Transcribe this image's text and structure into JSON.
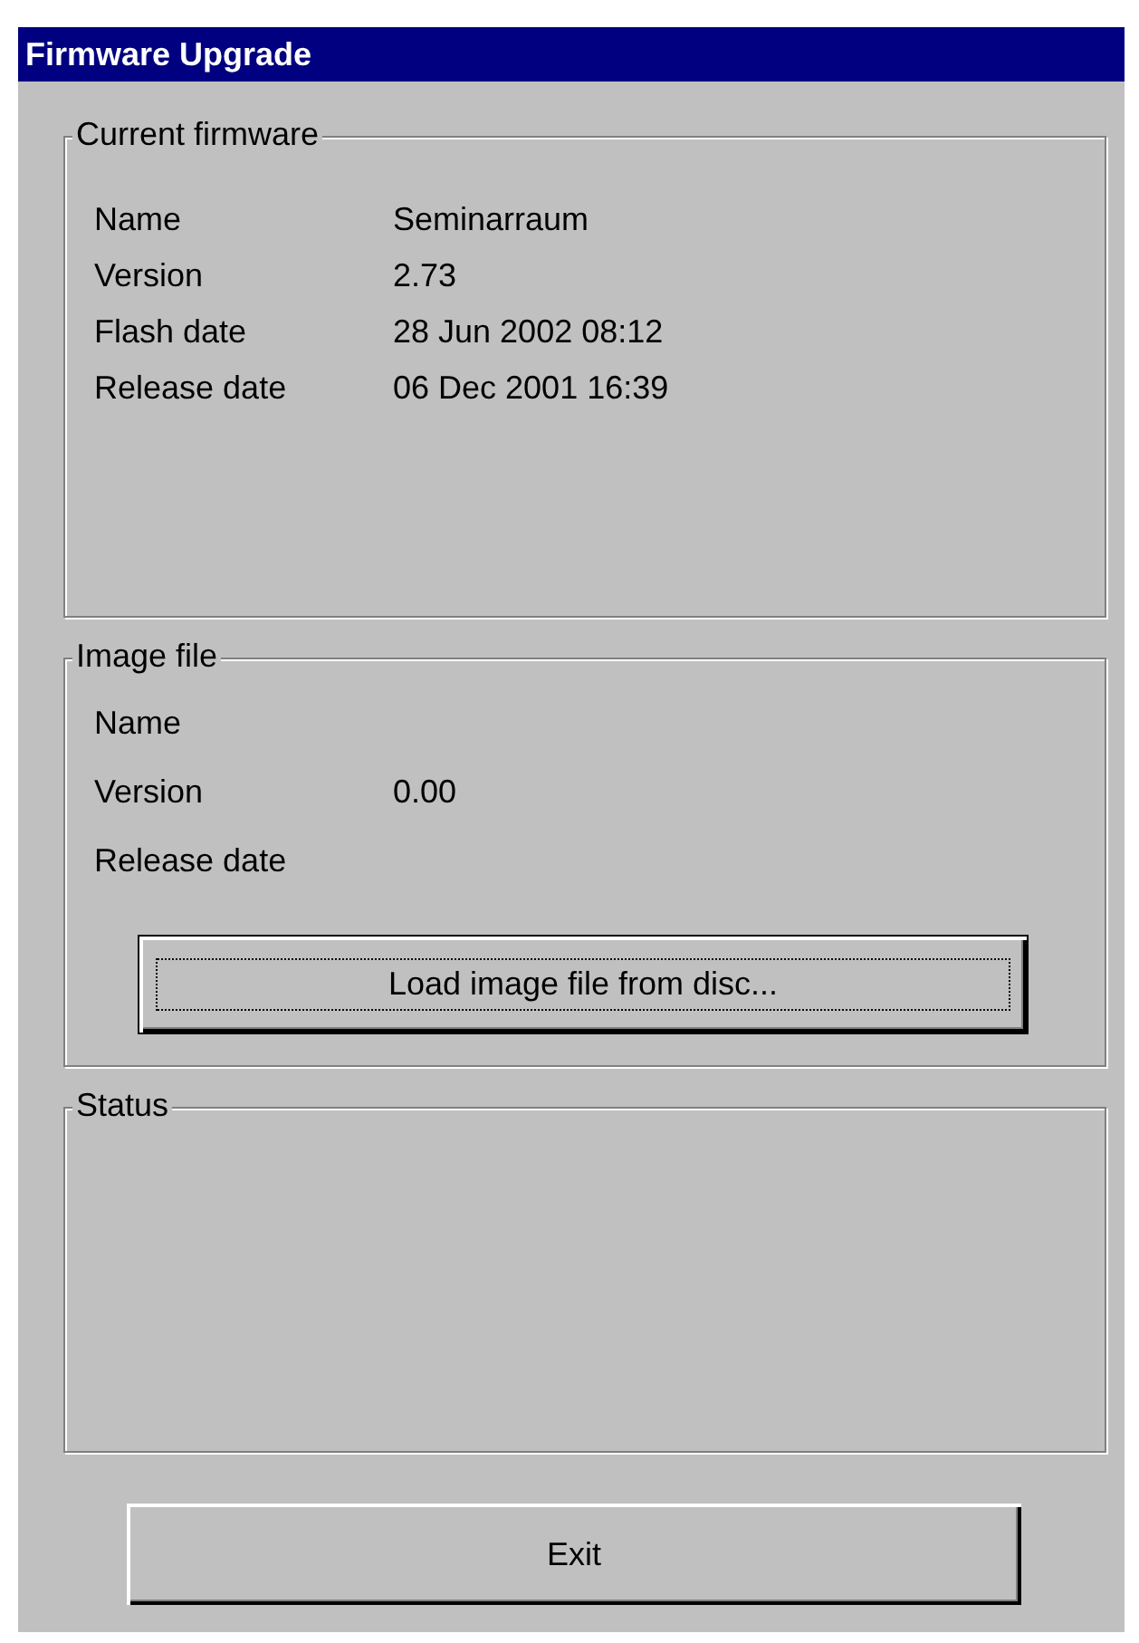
{
  "window": {
    "title": "Firmware Upgrade"
  },
  "current_firmware": {
    "title": "Current firmware",
    "rows": [
      {
        "label": "Name",
        "value": "Seminarraum"
      },
      {
        "label": "Version",
        "value": "2.73"
      },
      {
        "label": "Flash date",
        "value": "28 Jun 2002 08:12"
      },
      {
        "label": "Release date",
        "value": "06 Dec 2001 16:39"
      }
    ]
  },
  "image_file": {
    "title": "Image file",
    "rows": [
      {
        "label": "Name"
      },
      {
        "label": "Version",
        "value": "0.00"
      },
      {
        "label": "Release date"
      }
    ],
    "load_button": {
      "label": "Load image file from disc...",
      "focused": true
    }
  },
  "status": {
    "title": "Status"
  },
  "exit_button": {
    "label": "Exit"
  }
}
